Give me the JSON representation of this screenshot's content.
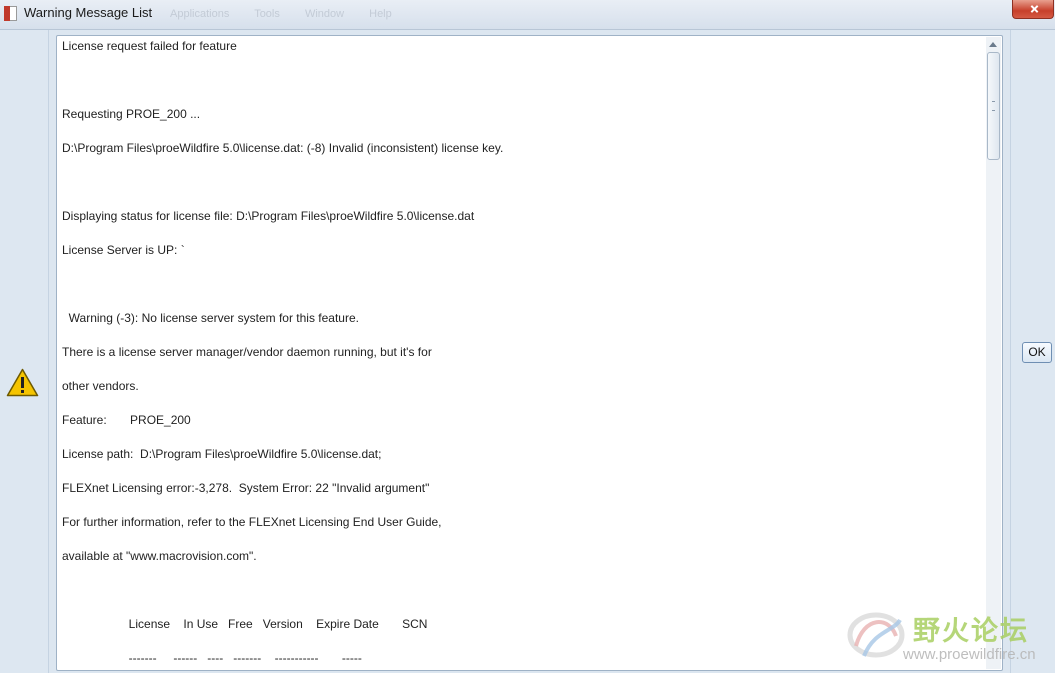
{
  "window": {
    "title": "Warning Message List",
    "ghost_menu": [
      "Applications",
      "Tools",
      "Window",
      "Help"
    ]
  },
  "messages": [
    "License request failed for feature",
    "",
    "Requesting PROE_200 ...",
    "D:\\Program Files\\proeWildfire 5.0\\license.dat: (-8) Invalid (inconsistent) license key.",
    "",
    "Displaying status for license file: D:\\Program Files\\proeWildfire 5.0\\license.dat",
    "License Server is UP: `",
    "",
    "  Warning (-3): No license server system for this feature.",
    "There is a license server manager/vendor daemon running, but it's for",
    "other vendors.",
    "Feature:       PROE_200",
    "License path:  D:\\Program Files\\proeWildfire 5.0\\license.dat;",
    "FLEXnet Licensing error:-3,278.  System Error: 22 \"Invalid argument\"",
    "For further information, refer to the FLEXnet Licensing End User Guide,",
    "available at \"www.macrovision.com\".",
    "",
    "                    License    In Use   Free   Version    Expire Date       SCN",
    "                    -------     ------   ----   -------    -----------       -----"
  ],
  "buttons": {
    "ok_label": "OK"
  },
  "watermark": {
    "cn_text": "野火论坛",
    "url": "www.proewildfire.cn"
  },
  "icons": {
    "warning": "warning-triangle-icon",
    "close": "close-icon"
  },
  "colors": {
    "warning_fill": "#f5c400",
    "close_button": "#c7402b",
    "watermark_green": "#a9cf62"
  }
}
